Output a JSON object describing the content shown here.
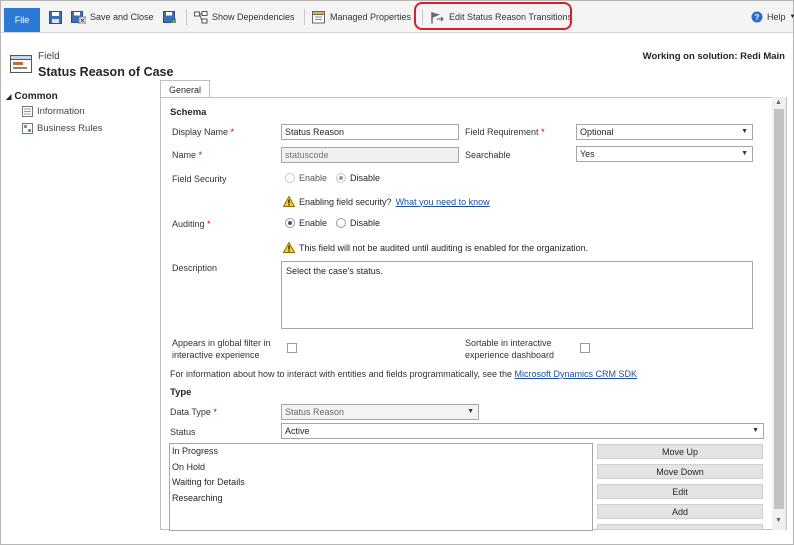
{
  "toolbar": {
    "file": "File",
    "save_and_close": "Save and Close",
    "show_dependencies": "Show Dependencies",
    "managed_properties": "Managed Properties",
    "edit_status_reason_transitions": "Edit Status Reason Transitions",
    "help": "Help"
  },
  "header": {
    "entity_label": "Field",
    "title": "Status Reason of Case",
    "solution": "Working on solution: Redi Main"
  },
  "nav": {
    "group": "Common",
    "items": [
      {
        "label": "Information"
      },
      {
        "label": "Business Rules"
      }
    ]
  },
  "tabs": [
    {
      "label": "General"
    }
  ],
  "schema": {
    "section": "Schema",
    "display_name_label": "Display Name",
    "display_name_value": "Status Reason",
    "field_requirement_label": "Field Requirement",
    "field_requirement_value": "Optional",
    "name_label": "Name",
    "name_value": "statuscode",
    "searchable_label": "Searchable",
    "searchable_value": "Yes",
    "field_security_label": "Field Security",
    "field_security_enable": "Enable",
    "field_security_disable": "Disable",
    "field_security_warning": "Enabling field security?",
    "field_security_link": "What you need to know",
    "auditing_label": "Auditing",
    "auditing_enable": "Enable",
    "auditing_disable": "Disable",
    "auditing_warning": "This field will not be audited until auditing is enabled for the organization.",
    "description_label": "Description",
    "description_value": "Select the case's status.",
    "global_filter_label_1": "Appears in global filter in",
    "global_filter_label_2": "interactive experience",
    "sortable_label_1": "Sortable in interactive",
    "sortable_label_2": "experience dashboard",
    "sdk_text": "For information about how to interact with entities and fields programmatically, see the",
    "sdk_link": "Microsoft Dynamics CRM SDK"
  },
  "type": {
    "section": "Type",
    "data_type_label": "Data Type",
    "data_type_value": "Status Reason",
    "status_label": "Status",
    "status_value": "Active",
    "options": [
      "In Progress",
      "On Hold",
      "Waiting for Details",
      "Researching"
    ],
    "buttons": {
      "move_up": "Move Up",
      "move_down": "Move Down",
      "edit": "Edit",
      "add": "Add"
    }
  },
  "colors": {
    "file_button": "#2b7bd6",
    "highlight": "#d61f26",
    "link": "#1a4fa0",
    "required": "#c60000"
  }
}
